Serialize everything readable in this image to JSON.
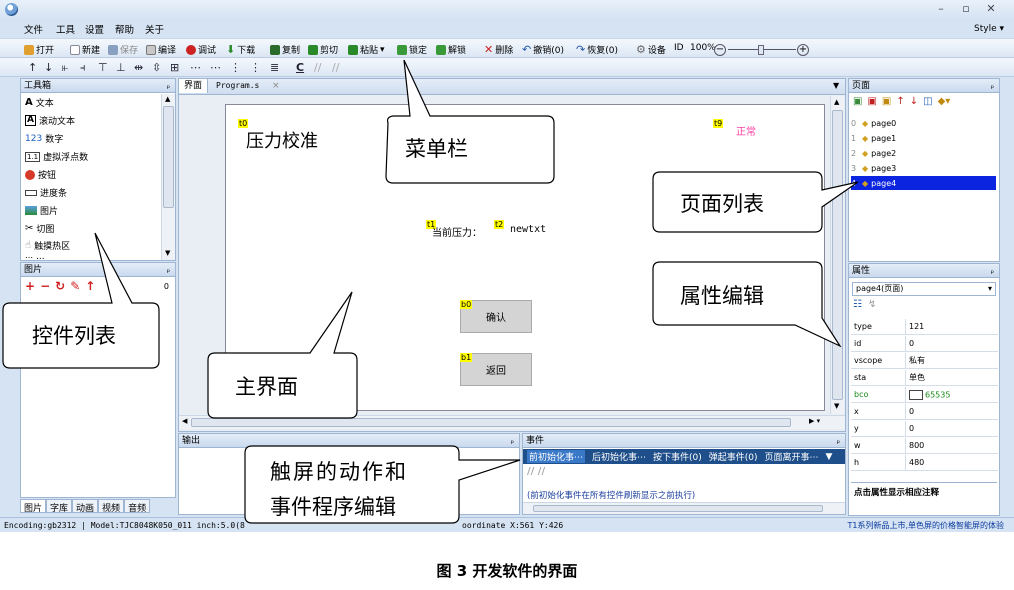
{
  "menu": [
    "文件",
    "工具",
    "设置",
    "帮助",
    "关于"
  ],
  "style_menu": "Style ▾",
  "window_controls": [
    "–",
    "▫",
    "✕"
  ],
  "toolbar": [
    {
      "label": "打开",
      "icon": "folder-open-icon",
      "color": "#e0a030"
    },
    {
      "label": "新建",
      "icon": "new-file-icon",
      "color": "#ffffff"
    },
    {
      "label": "保存",
      "icon": "save-icon",
      "color": "#8aa0c0"
    },
    {
      "label": "编译",
      "icon": "compile-icon",
      "color": "#c8c8c8"
    },
    {
      "label": "调试",
      "icon": "debug-icon",
      "color": "#cc2222"
    },
    {
      "label": "下载",
      "icon": "download-icon",
      "color": "#2a8a2a"
    },
    {
      "label": "复制",
      "icon": "copy-icon",
      "color": "#2a6a2a"
    },
    {
      "label": "剪切",
      "icon": "cut-icon",
      "color": "#2a8a2a"
    },
    {
      "label": "粘贴",
      "icon": "paste-icon",
      "color": "#2a8a2a"
    },
    {
      "label": "锁定",
      "icon": "lock-icon",
      "color": "#3a9a3a"
    },
    {
      "label": "解锁",
      "icon": "unlock-icon",
      "color": "#3a9a3a"
    },
    {
      "label": "删除",
      "icon": "delete-icon",
      "color": "#d02020"
    },
    {
      "label": "撤销(0)",
      "icon": "undo-icon",
      "color": "#2255aa"
    },
    {
      "label": "恢复(0)",
      "icon": "redo-icon",
      "color": "#2255aa"
    },
    {
      "label": "设备",
      "icon": "gear-icon",
      "color": "#888888"
    }
  ],
  "toolbar_id": "ID",
  "zoom": "100%",
  "toolbox": {
    "title": "工具箱",
    "items": [
      {
        "label": "文本",
        "icon": "text-icon"
      },
      {
        "label": "滚动文本",
        "icon": "scroll-text-icon"
      },
      {
        "label": "数字",
        "icon": "number-icon"
      },
      {
        "label": "虚拟浮点数",
        "icon": "float-icon"
      },
      {
        "label": "按钮",
        "icon": "button-icon"
      },
      {
        "label": "进度条",
        "icon": "progress-icon"
      },
      {
        "label": "图片",
        "icon": "picture-icon"
      },
      {
        "label": "切图",
        "icon": "crop-icon"
      },
      {
        "label": "触摸热区",
        "icon": "touch-icon"
      },
      {
        "label": "...",
        "icon": "more-icon"
      }
    ]
  },
  "pictures": {
    "title": "图片",
    "count": "0"
  },
  "bottom_tabs": [
    "图片",
    "字库",
    "动画",
    "视频",
    "音频"
  ],
  "doc_tabs": [
    "界面",
    "Program.s",
    "×"
  ],
  "canvas": {
    "title_tag": "t0",
    "title": "压力校准",
    "status_tag": "t9",
    "status": "正常",
    "label_tag": "t1",
    "label": "当前压力：",
    "value_tag": "t2",
    "value": "newtxt",
    "btn1_tag": "b0",
    "btn1": "确认",
    "btn2_tag": "b1",
    "btn2": "返回"
  },
  "output": {
    "title": "输出"
  },
  "events": {
    "title": "事件",
    "tabs": [
      "前初始化事⋯",
      "后初始化事⋯",
      "按下事件(0)",
      "弹起事件(0)",
      "页面离开事⋯"
    ],
    "note": "(前初始化事件在所有控件刷新显示之前执行)"
  },
  "pages": {
    "title": "页面",
    "items": [
      "page0",
      "page1",
      "page2",
      "page3",
      "page4"
    ],
    "selected": 4
  },
  "properties": {
    "title": "属性",
    "object": "page4(页面)",
    "rows": [
      {
        "k": "type",
        "v": "121"
      },
      {
        "k": "id",
        "v": "0"
      },
      {
        "k": "vscope",
        "v": "私有"
      },
      {
        "k": "sta",
        "v": "单色"
      },
      {
        "k": "bco",
        "v": "65535"
      },
      {
        "k": "x",
        "v": "0"
      },
      {
        "k": "y",
        "v": "0"
      },
      {
        "k": "w",
        "v": "800"
      },
      {
        "k": "h",
        "v": "480"
      }
    ],
    "hint": "点击属性显示相应注释"
  },
  "status": {
    "left": "Encoding:gb2312 | Model:TJC8048K050_011  inch:5.0(8",
    "coord": "oordinate X:561  Y:426",
    "right": "T1系列新品上市,单色屏的价格智能屏的体验"
  },
  "callouts": {
    "menubar": "菜单栏",
    "pagelist": "页面列表",
    "propedit": "属性编辑",
    "widgets": "控件列表",
    "main": "主界面",
    "events_l1": "触屏的动作和",
    "events_l2": "事件程序编辑"
  },
  "caption": "图 3  开发软件的界面"
}
